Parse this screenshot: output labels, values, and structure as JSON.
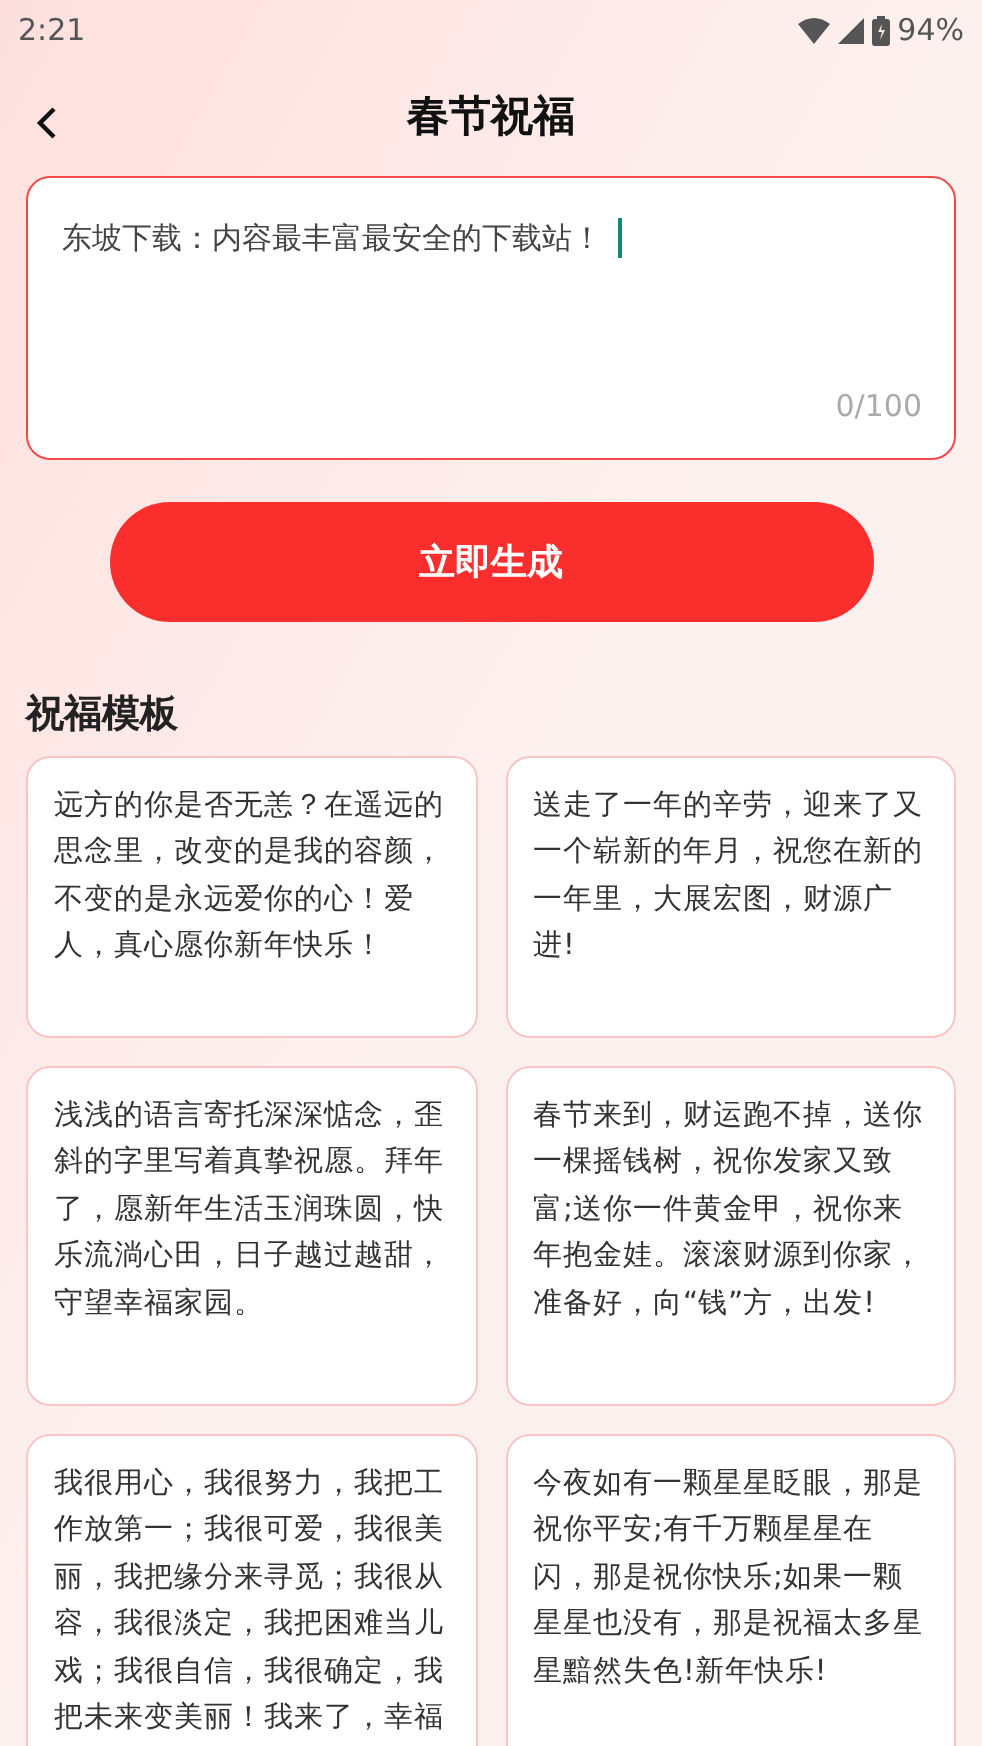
{
  "status_bar": {
    "time": "2:21",
    "battery": "94%"
  },
  "header": {
    "title": "春节祝福"
  },
  "input": {
    "value": "东坡下载：内容最丰富最安全的下载站！",
    "counter": "0/100"
  },
  "generate_button": {
    "label": "立即生成"
  },
  "templates": {
    "title": "祝福模板",
    "cards": [
      {
        "text": "远方的你是否无恙？在遥远的思念里，改变的是我的容颜，不变的是永远爱你的心！爱人，真心愿你新年快乐！"
      },
      {
        "text": "送走了一年的辛劳，迎来了又一个崭新的年月，祝您在新的一年里，大展宏图，财源广进!"
      },
      {
        "text": "浅浅的语言寄托深深惦念，歪斜的字里写着真挚祝愿。拜年了，愿新年生活玉润珠圆，快乐流淌心田，日子越过越甜，守望幸福家园。"
      },
      {
        "text": "春节来到，财运跑不掉，送你一棵摇钱树，祝你发家又致富;送你一件黄金甲，祝你来年抱金娃。滚滚财源到你家，准备好，向“钱”方，出发!"
      },
      {
        "text": "我很用心，我很努力，我把工作放第一；我很可爱，我很美丽，我把缘分来寻觅；我很从容，我很淡定，我把困难当儿戏；我很自信，我很确定，我把未来变美丽！我来了，幸福"
      },
      {
        "text": "今夜如有一颗星星眨眼，那是祝你平安;有千万颗星星在闪，那是祝你快乐;如果一颗星星也没有，那是祝福太多星星黯然失色!新年快乐!"
      }
    ]
  }
}
